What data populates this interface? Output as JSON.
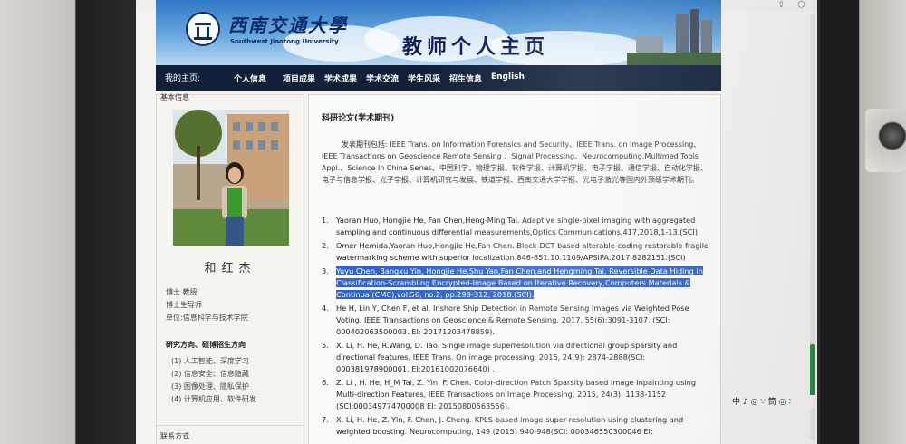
{
  "banner": {
    "school_cn": "西南交通大學",
    "school_en": "Southwest Jiaotong University",
    "title": "教师个人主页"
  },
  "nav": {
    "label": "我的主页:",
    "items": [
      "个人信息",
      "项目成果",
      "学术成果",
      "学术交流",
      "学生风采",
      "招生信息",
      "English"
    ]
  },
  "sidebar": {
    "section_title": "基本信息",
    "name": "和红杰",
    "title_line": "博士  教授",
    "supervisor_line": "博士生导师",
    "unit_line": "单位:信息科学与技术学院",
    "research_title": "研究方向、硕博招生方向",
    "research_items": [
      "(1)  人工智能、深度学习",
      "(2)  信息安全、信息隐藏",
      "(3)    图像处理、隐私保护",
      "(4)    计算机应用、软件研发"
    ],
    "contact_title": "联系方式"
  },
  "main": {
    "section_title": "科研论文(学术期刊)",
    "intro": "发表期刊包括: IEEE Trans. on Information Forensics and Security、IEEE Trans. on Image Processing、IEEE Transactions on Geoscience Remote Sensing 、Signal Processing、Neurocomputing,Multimed Tools Appl.、Science In China Series、中国科学、物理学报、软件学报、计算机学报、电子学报、通信学报、自动化学报、电子与信息学报、光子学报、计算机研究与发展、铁道学报、西南交通大学学报、光电子激光等国内外顶级学术期刊。",
    "publications": [
      {
        "num": "1.",
        "text": "Yaoran Huo, Hongjie He, Fan Chen,Heng-Ming Tai. Adaptive single-pixel imaging with aggregated sampling and continuous differential measurements,Optics Communications,417,2018,1-13.(SCI)",
        "highlighted": false
      },
      {
        "num": "2.",
        "text": "Omer Hemida,Yaoran Huo,Hongjie He,Fan Chen. Block-DCT based alterable-coding restorable fragile watermarking scheme with superior localization.846-851.10.1109/APSIPA.2017.8282151.(SCI)",
        "highlighted": false
      },
      {
        "num": "3.",
        "text": "Yuyu Chen, Bangxu Yin, Hongjie He,Shu Yan,Fan Chen,and Hengming Tai. Reversible Data Hiding in Classification-Scrambling Encrypted-Image Based on Iterative Recovery,Computers Materials & Continua (CMC),vol.56, no.2, pp.299-312, 2018.(SCI).",
        "highlighted": true
      },
      {
        "num": "4.",
        "text": "He H, Lin Y, Chen F, et al. Inshore Ship Detection in Remote Sensing Images via Weighted Pose Voting. IEEE Transactions on Geoscience & Remote Sensing, 2017, 55(6):3091-3107. (SCI: 000402063500003. EI: 20171203478859).",
        "highlighted": false
      },
      {
        "num": "5.",
        "text": "X. Li, H. He, R.Wang, D. Tao. Single image superresolution via directional group sparsity and directional features, IEEE Trans. On image processing, 2015, 24(9): 2874-2888(SCI: 000381978900001, EI:20161002076640) .",
        "highlighted": false
      },
      {
        "num": "6.",
        "text": "Z. Li , H. He, H_M Tai, Z. Yin, F. Chen. Color-direction Patch Sparsity based Image Inpainting using Multi-direction Features, IEEE Transactions on Image Processing, 2015, 24(3): 1138-1152 (SCI:000349774700008 EI: 20150800563556).",
        "highlighted": false
      },
      {
        "num": "7.",
        "text": "X. Li, H. He, Z. Yin, F. Chen, J. Cheng. KPLS-based image super-resolution using clustering and weighted boosting. Neurocomputing, 149 (2015) 940-948(SCI: 000346550300046 EI:",
        "highlighted": false
      }
    ]
  },
  "toolbar": {
    "text": "中 ♪ ◎ ∵ 筒 ◎ ⁝"
  }
}
